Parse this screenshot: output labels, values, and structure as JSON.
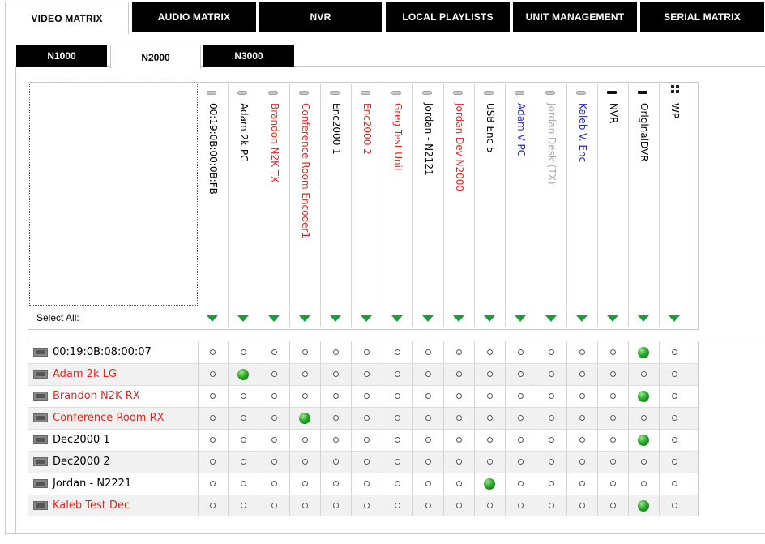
{
  "top_tabs": [
    {
      "label": "VIDEO MATRIX",
      "active": true
    },
    {
      "label": "AUDIO MATRIX",
      "active": false
    },
    {
      "label": "NVR",
      "active": false
    },
    {
      "label": "LOCAL PLAYLISTS",
      "active": false
    },
    {
      "label": "UNIT MANAGEMENT",
      "active": false
    },
    {
      "label": "SERIAL MATRIX",
      "active": false
    }
  ],
  "sub_tabs": [
    {
      "label": "N1000",
      "active": false
    },
    {
      "label": "N2000",
      "active": true
    },
    {
      "label": "N3000",
      "active": false
    }
  ],
  "select_all_label": "Select All:",
  "colors": {
    "red": "#e8231f",
    "blue": "#2222dd",
    "gray": "#a8a8a8",
    "black": "#000000",
    "green_arrow": "#1a9e3a"
  },
  "columns": [
    {
      "label": "00:19:0B:00:0B:FB",
      "color": "black",
      "icon": "encoder-icon"
    },
    {
      "label": "Adam 2k PC",
      "color": "black",
      "icon": "encoder-icon"
    },
    {
      "label": "Brandon N2K TX",
      "color": "red",
      "icon": "encoder-icon"
    },
    {
      "label": "Conference Room Encoder1",
      "color": "red",
      "icon": "encoder-icon"
    },
    {
      "label": "Enc2000 1",
      "color": "black",
      "icon": "encoder-icon"
    },
    {
      "label": "Enc2000 2",
      "color": "red",
      "icon": "encoder-icon"
    },
    {
      "label": "Greg Test Unit",
      "color": "red",
      "icon": "encoder-icon"
    },
    {
      "label": "Jordan - N2121",
      "color": "black",
      "icon": "encoder-icon"
    },
    {
      "label": "Jordan Dev N2000",
      "color": "red",
      "icon": "encoder-icon"
    },
    {
      "label": "USB Enc 5",
      "color": "black",
      "icon": "encoder-icon"
    },
    {
      "label": "Adam V PC",
      "color": "blue",
      "icon": "encoder-icon"
    },
    {
      "label": "Jordan Desk (TX)",
      "color": "gray",
      "icon": "encoder-icon"
    },
    {
      "label": "Kaleb V. Enc",
      "color": "blue",
      "icon": "encoder-icon"
    },
    {
      "label": "NVR",
      "color": "black",
      "icon": "nvr-icon"
    },
    {
      "label": "OriginalDVR",
      "color": "black",
      "icon": "nvr-icon"
    },
    {
      "label": "WP",
      "color": "black",
      "icon": "grid-icon"
    }
  ],
  "rows": [
    {
      "label": "00:19:0B:08:00:07",
      "color": "black",
      "active_col": 14
    },
    {
      "label": "Adam 2k LG",
      "color": "red",
      "active_col": 1
    },
    {
      "label": "Brandon N2K RX",
      "color": "red",
      "active_col": 14
    },
    {
      "label": "Conference Room RX",
      "color": "red",
      "active_col": 3
    },
    {
      "label": "Dec2000 1",
      "color": "black",
      "active_col": 14
    },
    {
      "label": "Dec2000 2",
      "color": "black",
      "active_col": -1
    },
    {
      "label": "Jordan - N2221",
      "color": "black",
      "active_col": 9
    },
    {
      "label": "Kaleb Test Dec",
      "color": "red",
      "active_col": 14
    }
  ]
}
